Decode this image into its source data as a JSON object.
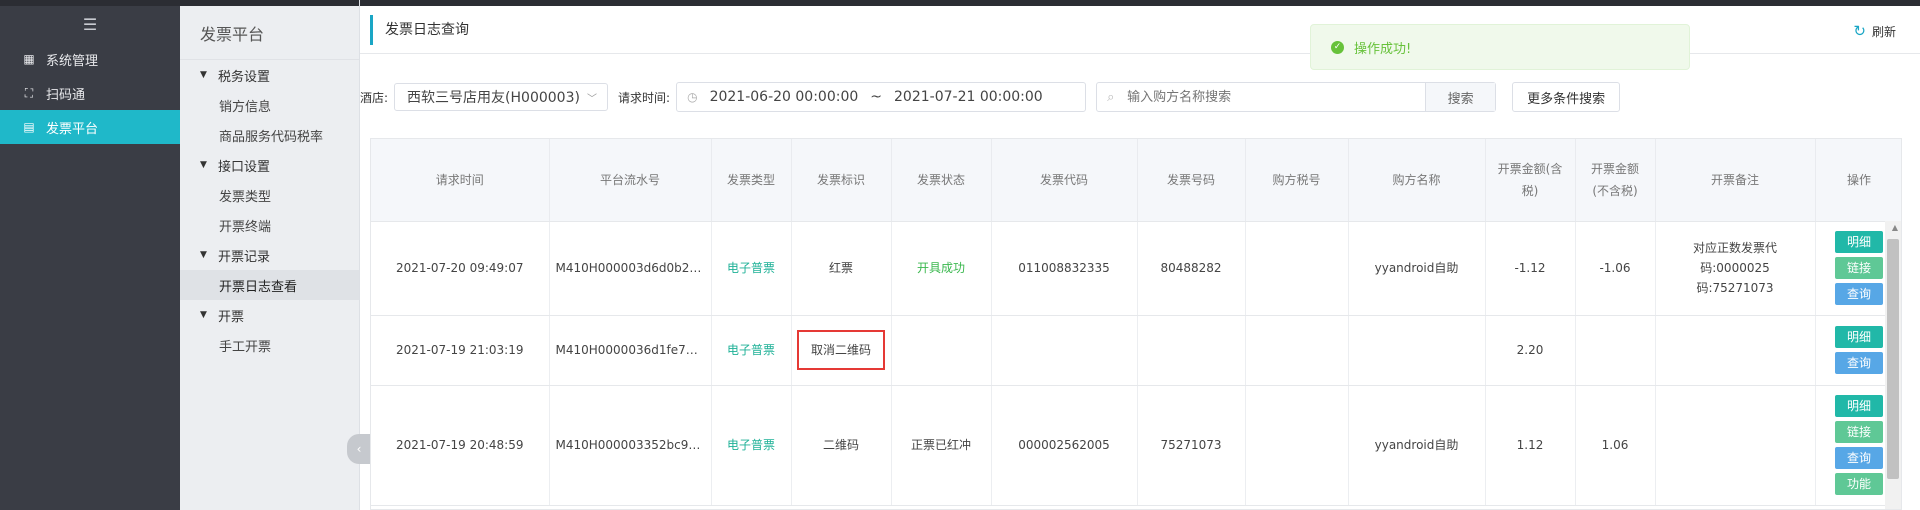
{
  "nav": {
    "items": [
      {
        "label": "系统管理",
        "icon": "grid-icon",
        "active": false
      },
      {
        "label": "扫码通",
        "icon": "scan-icon",
        "active": false
      },
      {
        "label": "发票平台",
        "icon": "invoice-icon",
        "active": true
      }
    ]
  },
  "subnav": {
    "title": "发票平台",
    "groups": [
      {
        "label": "税务设置",
        "items": [
          "销方信息",
          "商品服务代码税率"
        ]
      },
      {
        "label": "接口设置",
        "items": [
          "发票类型",
          "开票终端"
        ]
      },
      {
        "label": "开票记录",
        "items": [
          "开票日志查看"
        ]
      },
      {
        "label": "开票",
        "items": [
          "手工开票"
        ]
      }
    ],
    "active_item": "开票日志查看"
  },
  "header": {
    "title": "发票日志查询",
    "refresh_label": "刷新"
  },
  "toast": {
    "message": "操作成功!",
    "icon": "check-circle-icon",
    "color": "#67c23a"
  },
  "filters": {
    "hotel_label": "酒店:",
    "hotel_value": "西软三号店用友(H000003)",
    "time_label": "请求时间:",
    "date_start": "2021-06-20 00:00:00",
    "date_sep": "~",
    "date_end": "2021-07-21 00:00:00",
    "search_placeholder": "输入购方名称搜索",
    "search_button": "搜索",
    "more_button": "更多条件搜索"
  },
  "table": {
    "headers": [
      "请求时间",
      "平台流水号",
      "发票类型",
      "发票标识",
      "发票状态",
      "发票代码",
      "发票号码",
      "购方税号",
      "购方名称",
      "开票金额(含税)",
      "开票金额(不含税)",
      "开票备注",
      "操作"
    ],
    "rows": [
      {
        "time": "2021-07-20 09:49:07",
        "serial": "M410H000003d6d0b28...",
        "type": "电子普票",
        "mark": "红票",
        "status": "开具成功",
        "code": "011008832335",
        "number": "80488282",
        "tax_id": "",
        "buyer": "yyandroid自助",
        "amount_incl": "-1.12",
        "amount_excl": "-1.06",
        "remark": "对应正数发票代码:0000025 码:75271073",
        "ops": [
          "明细",
          "链接",
          "查询"
        ]
      },
      {
        "time": "2021-07-19 21:03:19",
        "serial": "M410H0000036d1fe726...",
        "type": "电子普票",
        "mark": "取消二维码",
        "status": "",
        "code": "",
        "number": "",
        "tax_id": "",
        "buyer": "",
        "amount_incl": "2.20",
        "amount_excl": "",
        "remark": "",
        "ops": [
          "明细",
          "查询"
        ]
      },
      {
        "time": "2021-07-19 20:48:59",
        "serial": "M410H000003352bc97...",
        "type": "电子普票",
        "mark": "二维码",
        "status": "正票已红冲",
        "code": "000002562005",
        "number": "75271073",
        "tax_id": "",
        "buyer": "yyandroid自助",
        "amount_incl": "1.12",
        "amount_excl": "1.06",
        "remark": "",
        "ops": [
          "明细",
          "链接",
          "查询",
          "功能"
        ]
      }
    ]
  },
  "colors": {
    "accent": "#1fb8c9",
    "nav_bg": "#3a3d45",
    "link_green": "#1fb197",
    "highlight": "#e53935"
  }
}
